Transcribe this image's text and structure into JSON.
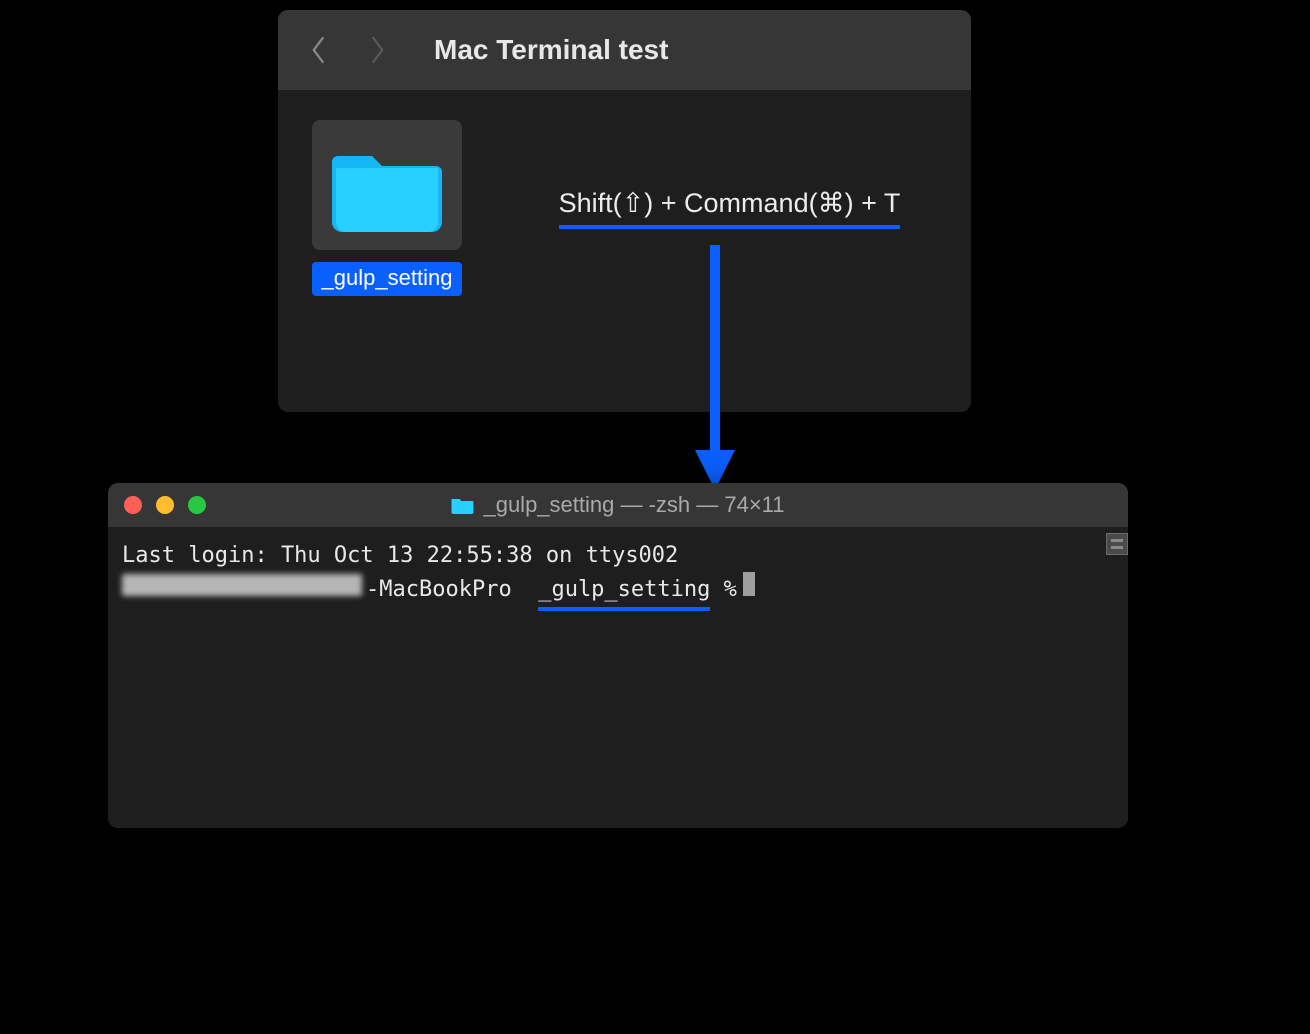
{
  "finder": {
    "title": "Mac Terminal test",
    "folder_name": "_gulp_setting",
    "shortcut": "Shift(⇧) + Command(⌘) + T"
  },
  "terminal": {
    "title": "_gulp_setting — -zsh — 74×11",
    "last_login": "Last login: Thu Oct 13 22:55:38 on ttys002",
    "host_suffix": "-MacBookPro",
    "cwd": "_gulp_setting",
    "prompt_symbol": "%"
  },
  "colors": {
    "accent": "#0a60ff",
    "folder": "#1ec8ff"
  }
}
